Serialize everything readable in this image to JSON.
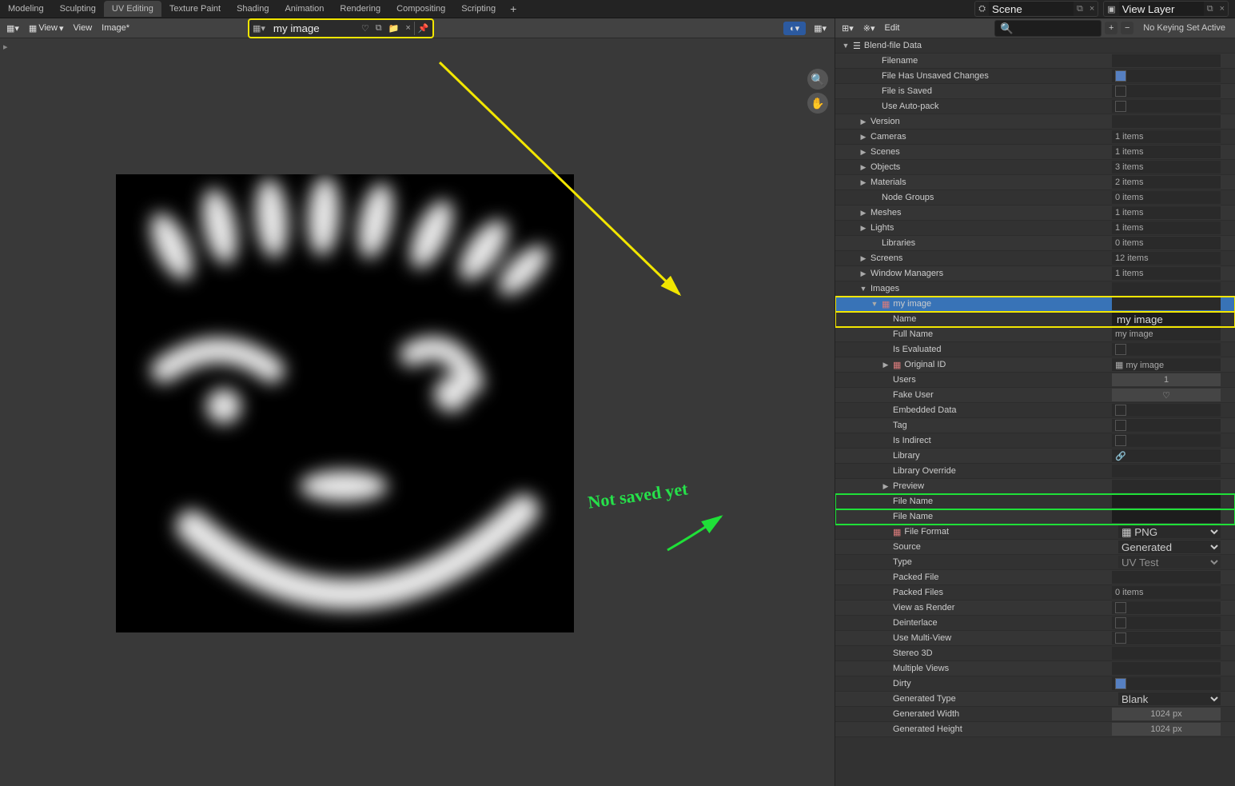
{
  "tabs": [
    "Modeling",
    "Sculpting",
    "UV Editing",
    "Texture Paint",
    "Shading",
    "Animation",
    "Rendering",
    "Compositing",
    "Scripting"
  ],
  "active_tab": "UV Editing",
  "scene": {
    "label": "Scene"
  },
  "viewlayer": {
    "label": "View Layer"
  },
  "view_menu": {
    "view": "View",
    "view2": "View",
    "image": "Image*"
  },
  "image_name": "my image",
  "dope": {
    "mode": "Edit",
    "keying": "No Keying Set Active",
    "search": ""
  },
  "annot": {
    "not_saved": "Not\nsaved\nyet"
  },
  "outliner": {
    "root": "Blend-file Data",
    "items": [
      {
        "k": "Filename",
        "v": "",
        "type": "text",
        "indent": 2
      },
      {
        "k": "File Has Unsaved Changes",
        "v": true,
        "type": "check",
        "indent": 2
      },
      {
        "k": "File is Saved",
        "v": false,
        "type": "check",
        "indent": 2
      },
      {
        "k": "Use Auto-pack",
        "v": false,
        "type": "check",
        "indent": 2
      },
      {
        "k": "Version",
        "v": "",
        "type": "expand",
        "indent": 1
      },
      {
        "k": "Cameras",
        "v": "1 items",
        "type": "expand",
        "indent": 1
      },
      {
        "k": "Scenes",
        "v": "1 items",
        "type": "expand",
        "indent": 1
      },
      {
        "k": "Objects",
        "v": "3 items",
        "type": "expand",
        "indent": 1
      },
      {
        "k": "Materials",
        "v": "2 items",
        "type": "expand",
        "indent": 1
      },
      {
        "k": "Node Groups",
        "v": "0 items",
        "type": "text",
        "indent": 2
      },
      {
        "k": "Meshes",
        "v": "1 items",
        "type": "expand",
        "indent": 1
      },
      {
        "k": "Lights",
        "v": "1 items",
        "type": "expand",
        "indent": 1
      },
      {
        "k": "Libraries",
        "v": "0 items",
        "type": "text",
        "indent": 2
      },
      {
        "k": "Screens",
        "v": "12 items",
        "type": "expand",
        "indent": 1
      },
      {
        "k": "Window Managers",
        "v": "1 items",
        "type": "expand",
        "indent": 1
      },
      {
        "k": "Images",
        "v": "",
        "type": "open",
        "indent": 1
      },
      {
        "k": "my image",
        "v": "",
        "type": "open",
        "indent": 2,
        "selected": true,
        "hl": "yellow",
        "icon": "img"
      },
      {
        "k": "Name",
        "v": "my image",
        "type": "input",
        "indent": 3,
        "hl": "yellow"
      },
      {
        "k": "Full Name",
        "v": "my image",
        "type": "text",
        "indent": 3
      },
      {
        "k": "Is Evaluated",
        "v": false,
        "type": "check",
        "indent": 3
      },
      {
        "k": "Original ID",
        "v": "my image",
        "type": "expand",
        "indent": 3,
        "icon": "img"
      },
      {
        "k": "Users",
        "v": "1",
        "type": "textcenter",
        "indent": 3
      },
      {
        "k": "Fake User",
        "v": "shield",
        "type": "shield",
        "indent": 3
      },
      {
        "k": "Embedded Data",
        "v": false,
        "type": "check",
        "indent": 3
      },
      {
        "k": "Tag",
        "v": false,
        "type": "check",
        "indent": 3
      },
      {
        "k": "Is Indirect",
        "v": false,
        "type": "check",
        "indent": 3
      },
      {
        "k": "Library",
        "v": "link",
        "type": "link",
        "indent": 3
      },
      {
        "k": "Library Override",
        "v": "",
        "type": "text",
        "indent": 3
      },
      {
        "k": "Preview",
        "v": "",
        "type": "expand",
        "indent": 3
      },
      {
        "k": "File Name",
        "v": "",
        "type": "input",
        "indent": 3,
        "hl": "green"
      },
      {
        "k": "File Name",
        "v": "",
        "type": "input",
        "indent": 3,
        "hl": "green"
      },
      {
        "k": "File Format",
        "v": "PNG",
        "type": "dropdown",
        "indent": 3,
        "icon": "img"
      },
      {
        "k": "Source",
        "v": "Generated",
        "type": "dropdown",
        "indent": 3
      },
      {
        "k": "Type",
        "v": "UV Test",
        "type": "dropdown",
        "indent": 3,
        "dis": true
      },
      {
        "k": "Packed File",
        "v": "",
        "type": "text",
        "indent": 3
      },
      {
        "k": "Packed Files",
        "v": "0 items",
        "type": "text",
        "indent": 3
      },
      {
        "k": "View as Render",
        "v": false,
        "type": "check",
        "indent": 3
      },
      {
        "k": "Deinterlace",
        "v": false,
        "type": "check",
        "indent": 3
      },
      {
        "k": "Use Multi-View",
        "v": false,
        "type": "check",
        "indent": 3
      },
      {
        "k": "Stereo 3D",
        "v": "",
        "type": "text",
        "indent": 3
      },
      {
        "k": "Multiple Views",
        "v": "",
        "type": "text",
        "indent": 3
      },
      {
        "k": "Dirty",
        "v": true,
        "type": "check",
        "indent": 3
      },
      {
        "k": "Generated Type",
        "v": "Blank",
        "type": "dropdown",
        "indent": 3
      },
      {
        "k": "Generated Width",
        "v": "1024 px",
        "type": "num",
        "indent": 3
      },
      {
        "k": "Generated Height",
        "v": "1024 px",
        "type": "num",
        "indent": 3
      }
    ]
  }
}
